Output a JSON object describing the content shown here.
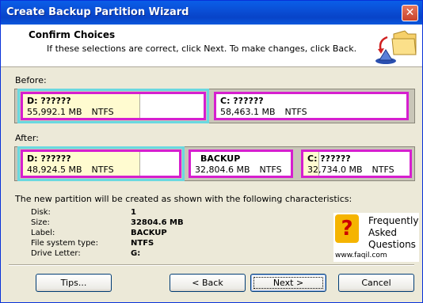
{
  "window": {
    "title": "Create Backup Partition Wizard",
    "close_glyph": "✕"
  },
  "header": {
    "title": "Confirm Choices",
    "subtitle": "If these selections are correct, click Next. To make changes, click Back."
  },
  "before": {
    "label": "Before:",
    "partitions": [
      {
        "name": "D:  ??????",
        "size": "55,992.1 MB",
        "fs": "NTFS",
        "used_fraction": 0.62,
        "selected": true
      },
      {
        "name": "C:  ??????",
        "size": "58,463.1 MB",
        "fs": "NTFS",
        "used_fraction": 0.0,
        "selected": false
      }
    ]
  },
  "after": {
    "label": "After:",
    "partitions": [
      {
        "name": "D:  ??????",
        "size": "48,924.5 MB",
        "fs": "NTFS",
        "used_fraction": 0.71,
        "selected": true
      },
      {
        "name": "BACKUP",
        "size": "32,804.6 MB",
        "fs": "NTFS",
        "used_fraction": 0.0,
        "selected": false
      },
      {
        "name": "C:  ??????",
        "size": "32,734.0 MB",
        "fs": "NTFS",
        "used_fraction": 0.15,
        "selected": false
      }
    ]
  },
  "characteristics": {
    "intro": "The new partition will be created as shown with the following characteristics:",
    "rows": [
      {
        "key": "Disk:",
        "value": "1"
      },
      {
        "key": "Size:",
        "value": "32804.6 MB"
      },
      {
        "key": "Label:",
        "value": "BACKUP"
      },
      {
        "key": "File system type:",
        "value": "NTFS"
      },
      {
        "key": "Drive Letter:",
        "value": "G:"
      }
    ]
  },
  "watermark": {
    "q": "?",
    "line1": "Frequently",
    "line2": "Asked",
    "line3": "Questions",
    "url": "www.faqil.com"
  },
  "buttons": {
    "tips": "Tips...",
    "back": "< Back",
    "next": "Next >",
    "cancel": "Cancel"
  }
}
